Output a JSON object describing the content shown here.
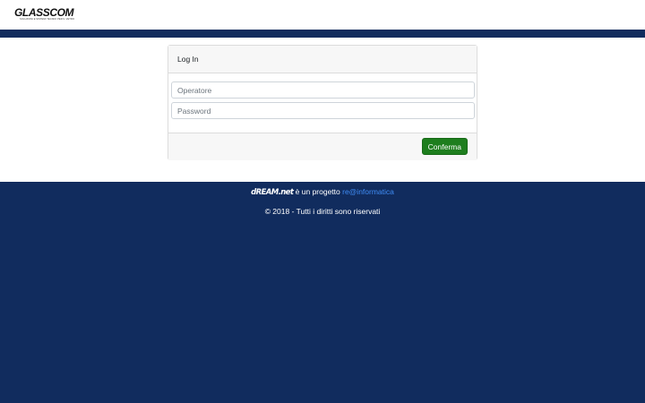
{
  "header": {
    "logo_text": "GLASSCOM",
    "logo_tagline": "SOLUZIONI E SISTEMI TECNICI PER IL VETRO"
  },
  "login": {
    "title": "Log In",
    "operator_placeholder": "Operatore",
    "password_placeholder": "Password",
    "confirm_label": "Conferma"
  },
  "footer": {
    "brand": "dREAM.net",
    "project_text": " è un progetto ",
    "company_link": "re@informatica",
    "copyright": "© 2018 - Tutti i diritti sono riservati"
  },
  "colors": {
    "navy": "#112c5e",
    "confirm_button": "#1e7e1e",
    "link": "#3f8cf5"
  }
}
